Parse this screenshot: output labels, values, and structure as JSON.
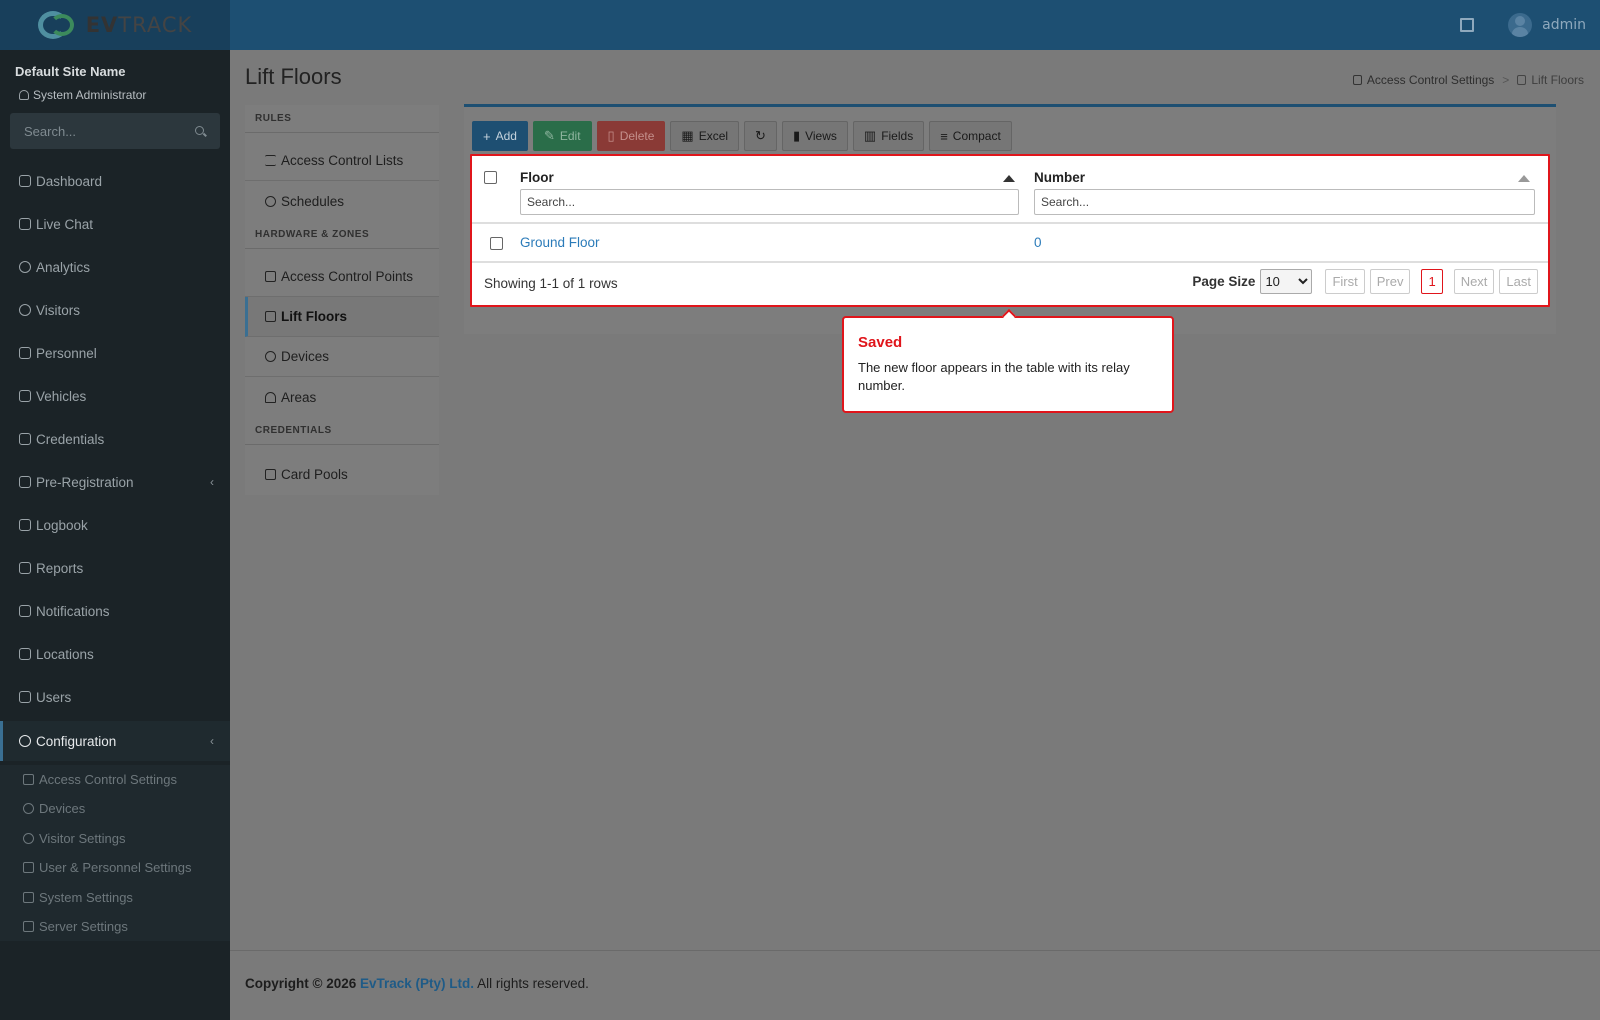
{
  "app": {
    "logo_ev": "EV",
    "logo_track": "TRACK",
    "user": "admin"
  },
  "sidebar": {
    "site_name": "Default Site Name",
    "role": "System Administrator",
    "search_placeholder": "Search...",
    "items": [
      {
        "label": "Dashboard",
        "icon": "dashboard-icon"
      },
      {
        "label": "Live Chat",
        "icon": "headset-icon"
      },
      {
        "label": "Analytics",
        "icon": "analytics-icon"
      },
      {
        "label": "Visitors",
        "icon": "eye-icon"
      },
      {
        "label": "Personnel",
        "icon": "personnel-icon"
      },
      {
        "label": "Vehicles",
        "icon": "car-icon"
      },
      {
        "label": "Credentials",
        "icon": "id-card-icon"
      },
      {
        "label": "Pre-Registration",
        "icon": "arrows-icon"
      },
      {
        "label": "Logbook",
        "icon": "book-icon"
      },
      {
        "label": "Reports",
        "icon": "chart-icon"
      },
      {
        "label": "Notifications",
        "icon": "chat-icon"
      },
      {
        "label": "Locations",
        "icon": "map-icon"
      },
      {
        "label": "Users",
        "icon": "users-icon"
      },
      {
        "label": "Configuration",
        "icon": "gear-icon"
      }
    ],
    "sub_items": [
      {
        "label": "Access Control Settings",
        "icon": "lock-icon"
      },
      {
        "label": "Devices",
        "icon": "device-icon"
      },
      {
        "label": "Visitor Settings",
        "icon": "eye-icon"
      },
      {
        "label": "User & Personnel Settings",
        "icon": "user-settings-icon"
      },
      {
        "label": "System Settings",
        "icon": "sliders-icon"
      },
      {
        "label": "Server Settings",
        "icon": "server-icon"
      }
    ]
  },
  "page": {
    "title": "Lift Floors",
    "breadcrumb": [
      "Access Control Settings",
      "Lift Floors"
    ]
  },
  "rules_panel": {
    "sections": [
      "RULES",
      "HARDWARE & ZONES",
      "CREDENTIALS"
    ],
    "items": [
      "Access Control Lists",
      "Schedules",
      "Access Control Points",
      "Lift Floors",
      "Devices",
      "Areas",
      "Card Pools"
    ]
  },
  "toolbar": {
    "add": "Add",
    "edit": "Edit",
    "delete": "Delete",
    "excel": "Excel",
    "views": "Views",
    "fields": "Fields",
    "compact": "Compact"
  },
  "table": {
    "columns": [
      "Floor",
      "Number"
    ],
    "search_placeholder": "Search...",
    "rows": [
      {
        "floor": "Ground Floor",
        "number": "0"
      }
    ],
    "showing": "Showing 1-1 of 1 rows",
    "page_size_label": "Page Size",
    "page_size": "10",
    "pager": {
      "first": "First",
      "prev": "Prev",
      "current": "1",
      "next": "Next",
      "last": "Last"
    }
  },
  "tooltip": {
    "title": "Saved",
    "body": "The new floor appears in the table with its relay number."
  },
  "footer": {
    "copyright": "Copyright © 2026",
    "company": "EvTrack (Pty) Ltd.",
    "rights": "All rights reserved."
  },
  "colors": {
    "accent": "#1d4f72",
    "highlight": "#e0151b",
    "link": "#2b7bb9"
  }
}
